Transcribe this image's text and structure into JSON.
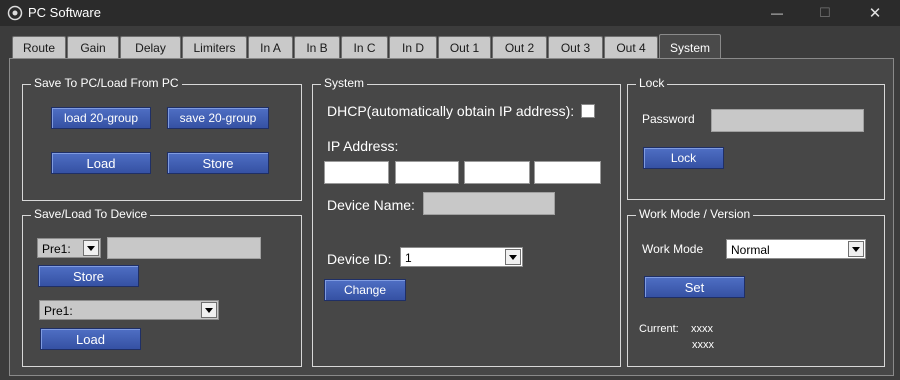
{
  "window": {
    "title": "PC Software",
    "minimize_glyph": "—",
    "maximize_glyph": "☐",
    "close_glyph": "✕"
  },
  "tabs": [
    {
      "label": "Route"
    },
    {
      "label": "Gain"
    },
    {
      "label": "Delay"
    },
    {
      "label": "Limiters"
    },
    {
      "label": "In A"
    },
    {
      "label": "In B"
    },
    {
      "label": "In C"
    },
    {
      "label": "In D"
    },
    {
      "label": "Out 1"
    },
    {
      "label": "Out 2"
    },
    {
      "label": "Out 3"
    },
    {
      "label": "Out 4"
    },
    {
      "label": "System"
    }
  ],
  "active_tab": "System",
  "pc_group": {
    "title": "Save To PC/Load From PC",
    "load_group_label": "load 20-group",
    "save_group_label": "save 20-group",
    "load_label": "Load",
    "store_label": "Store"
  },
  "device_group": {
    "title": "Save/Load To Device",
    "store_preset": "Pre1:",
    "store_name": "",
    "store_label": "Store",
    "load_preset": "Pre1:",
    "load_label": "Load"
  },
  "system_group": {
    "title": "System",
    "dhcp_label": "DHCP(automatically obtain IP address):",
    "dhcp_checked": false,
    "ip_label": "IP Address:",
    "ip_octets": [
      "",
      "",
      "",
      ""
    ],
    "device_name_label": "Device Name:",
    "device_name": "",
    "device_id_label": "Device ID:",
    "device_id": "1",
    "change_label": "Change"
  },
  "lock_group": {
    "title": "Lock",
    "password_label": "Password",
    "password": "",
    "lock_label": "Lock"
  },
  "workmode_group": {
    "title": "Work Mode / Version",
    "work_mode_label": "Work Mode",
    "work_mode": "Normal",
    "set_label": "Set",
    "current_label": "Current:",
    "current_line1": "xxxx",
    "current_line2": "xxxx"
  },
  "colors": {
    "button": "#4566bd",
    "panel": "#474747",
    "titlebar": "#2b2b2b"
  }
}
